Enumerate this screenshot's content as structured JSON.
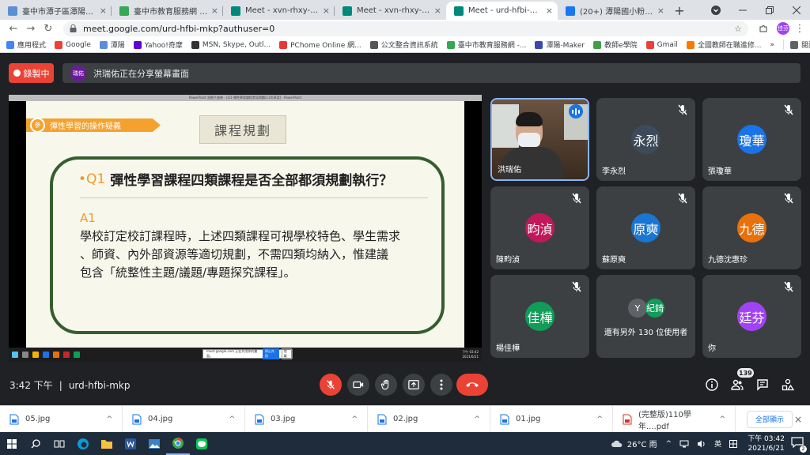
{
  "browser": {
    "tabs": [
      {
        "title": "臺中市潭子區潭陽國民小學",
        "favicon_color": "#5b8fd6",
        "active": false
      },
      {
        "title": "臺中市教育服務網 - 校園活...",
        "favicon_color": "#34a853",
        "active": false
      },
      {
        "title": "Meet - xvn-rhxy-zbd",
        "favicon_color": "#00897b",
        "active": false
      },
      {
        "title": "Meet - xvn-rhxy-zbd",
        "favicon_color": "#00897b",
        "active": false
      },
      {
        "title": "Meet - urd-hfbi-mkp",
        "favicon_color": "#00897b",
        "active": true
      },
      {
        "title": "(20+) 潭陽國小粉絲團 | Fac",
        "favicon_color": "#1877f2",
        "active": false
      }
    ],
    "tab_close_glyph": "×",
    "new_tab_glyph": "+",
    "url": "meet.google.com/urd-hfbi-mkp?authuser=0",
    "profile_initials": "佳芬",
    "bookmarks": [
      {
        "label": "應用程式",
        "color": "#4285f4"
      },
      {
        "label": "Google",
        "color": "#ea4335"
      },
      {
        "label": "潭陽",
        "color": "#5b8fd6"
      },
      {
        "label": "Yahoo!奇摩",
        "color": "#6001d2"
      },
      {
        "label": "MSN, Skype, Outl...",
        "color": "#333333"
      },
      {
        "label": "PChome Online 網...",
        "color": "#e53935"
      },
      {
        "label": "公文整合資訊系統",
        "color": "#555555"
      },
      {
        "label": "臺中市教育服務網 -...",
        "color": "#34a853"
      },
      {
        "label": "潭陽-Maker",
        "color": "#3949ab"
      },
      {
        "label": "教師e學院",
        "color": "#43a047"
      },
      {
        "label": "Gmail",
        "color": "#ea4335"
      },
      {
        "label": "全國教師在職進修...",
        "color": "#f57c00"
      }
    ],
    "bookmarks_more": "»",
    "reading_list": "閱讀清單"
  },
  "meet": {
    "recording_label": "錄製中",
    "presenter_initials": "瑞佑",
    "presenting_text": "洪瑞佑正在分享螢幕畫面",
    "shared_window_title": "PowerPoint 投影片放映 - [Q1-彈性學習課程常見問題(110)草案] - PowerPoint",
    "slide": {
      "ribbon_number": "參",
      "ribbon_text": "彈性學習的操作疑義",
      "tag": "課程規劃",
      "question_prefix": "Q1",
      "question": "彈性學習課程四類課程是否全部都須規劃執行？",
      "answer_prefix": "A1",
      "answer_lines": [
        "學校訂定校訂課程時，上述四類課程可視學校特色、學生需求",
        "、師資、內外部資源等適切規劃，不需四類均納入，惟建議",
        "包含「統整性主題/議題/專題探究課程」。"
      ]
    },
    "sharing_popup": {
      "text": "meet.google.com 正在共用你的畫面。",
      "stop": "停止共用",
      "hide": "隱藏"
    },
    "shared_taskbar_clock": {
      "time": "下午 03:42",
      "date": "2021/6/21"
    },
    "participants": [
      {
        "name": "洪瑞佑",
        "avatar": "",
        "color": "",
        "speaking": true
      },
      {
        "name": "李永烈",
        "avatar": "永烈",
        "color": "#3d4a59"
      },
      {
        "name": "張瓊華",
        "avatar": "瓊華",
        "color": "#1a73e8"
      },
      {
        "name": "陳畇湞",
        "avatar": "畇湞",
        "color": "#c2185b"
      },
      {
        "name": "蘇原奭",
        "avatar": "原奭",
        "color": "#1976d2"
      },
      {
        "name": "九德沈惠珍",
        "avatar": "九德",
        "color": "#e8710a"
      },
      {
        "name": "楊佳樺",
        "avatar": "佳樺",
        "color": "#0f9d58"
      },
      {
        "name": "還有另外 130 位使用者",
        "avatar": "",
        "color": ""
      },
      {
        "name": "你",
        "avatar": "廷芬",
        "color": "#a142f4"
      }
    ],
    "others_mini": [
      {
        "label": "Y",
        "color": "#5f6368"
      },
      {
        "label": "紀錡",
        "color": "#0f9d58"
      }
    ],
    "time": "3:42 下午",
    "meeting_code": "urd-hfbi-mkp",
    "participant_count": "139"
  },
  "downloads": {
    "items": [
      "05.jpg",
      "04.jpg",
      "03.jpg",
      "02.jpg",
      "01.jpg",
      "(完整版)110學年....pdf"
    ],
    "chevron": "^",
    "show_all": "全部顯示",
    "close": "×"
  },
  "taskbar": {
    "weather": "26°C 雨",
    "input_method": "英",
    "time": "下午 03:42",
    "date": "2021/6/21",
    "notifications": "2"
  }
}
